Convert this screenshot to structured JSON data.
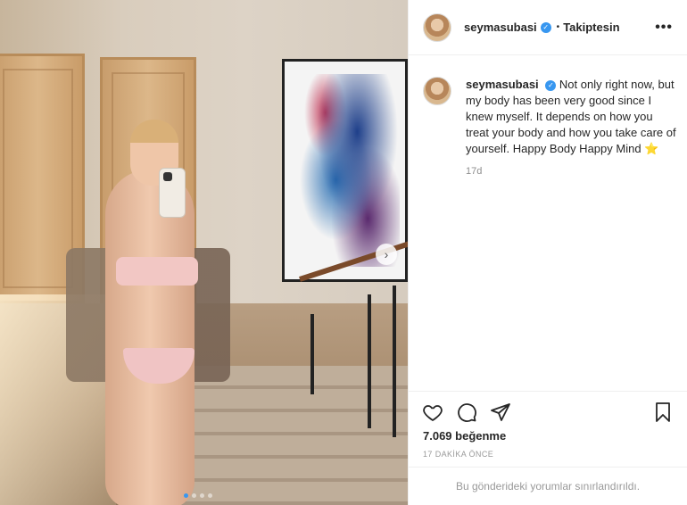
{
  "header": {
    "username": "seymasubasi",
    "separator": "•",
    "follow_label": "Takiptesin",
    "more_label": "•••"
  },
  "caption": {
    "username": "seymasubasi",
    "text": "Not only right now, but my body has been very good since I knew myself. It depends on how you treat your body and how you take care of yourself. Happy Body Happy Mind",
    "emoji": "⭐",
    "age": "17d"
  },
  "photo": {
    "carousel_count": 4,
    "active_index": 0,
    "next_label": "›"
  },
  "stats": {
    "likes": "7.069 beğenme",
    "time_ago": "17 DAKİKA ÖNCE"
  },
  "comments": {
    "limited_notice": "Bu gönderideki yorumlar sınırlandırıldı."
  },
  "icons": [
    "heart-icon",
    "comment-icon",
    "share-icon",
    "bookmark-icon",
    "verified-icon"
  ],
  "colors": {
    "verified": "#3897f0",
    "text": "#262626",
    "muted": "#8e8e8e"
  }
}
